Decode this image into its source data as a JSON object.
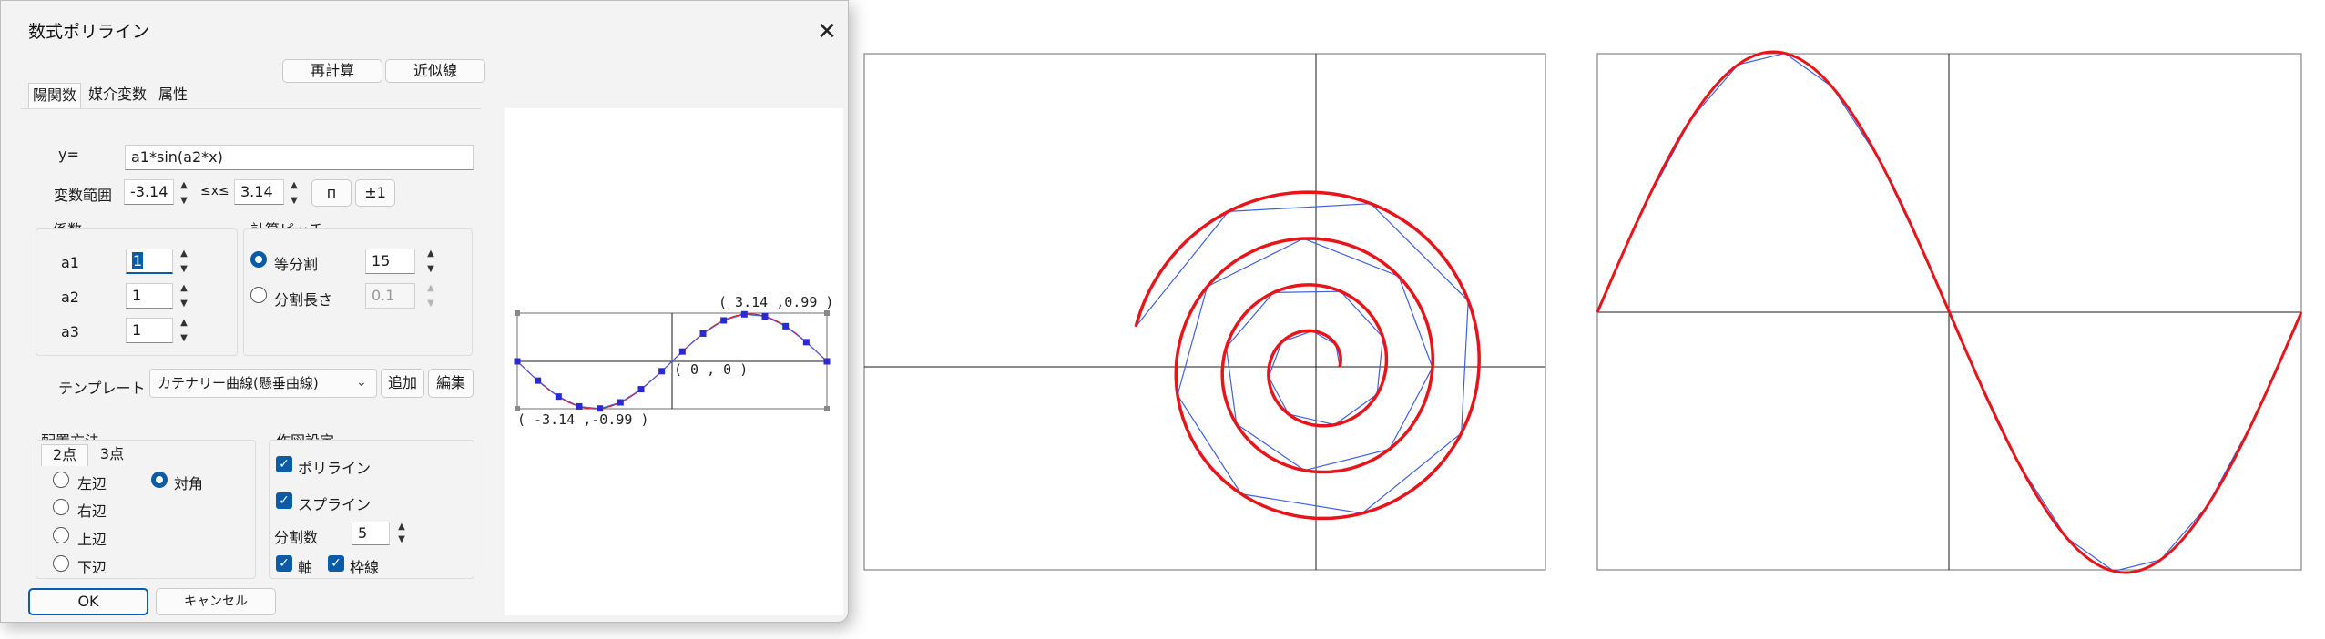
{
  "dialog": {
    "title": "数式ポリライン",
    "close_icon": "close-icon",
    "recalc_label": "再計算",
    "approx_label": "近似線",
    "tabs": [
      {
        "label": "陽関数",
        "active": true
      },
      {
        "label": "媒介変数",
        "active": false
      },
      {
        "label": "属性",
        "active": false
      }
    ],
    "formula": {
      "label": "y=",
      "value": "a1*sin(a2*x)"
    },
    "range": {
      "label": "変数範囲",
      "min": "-3.14",
      "mid_label": "≤x≤",
      "max": "3.14",
      "pi_button": "п",
      "pm1_button": "±1"
    },
    "coefficients": {
      "title": "係数",
      "items": [
        {
          "label": "a1",
          "value": "1"
        },
        {
          "label": "a2",
          "value": "1"
        },
        {
          "label": "a3",
          "value": "1"
        }
      ]
    },
    "pitch": {
      "title": "計算ピッチ",
      "equal_label": "等分割",
      "equal_value": "15",
      "length_label": "分割長さ",
      "length_value": "0.1",
      "selected": "等分割"
    },
    "template": {
      "label": "テンプレート",
      "selected": "カテナリー曲線(懸垂曲線)",
      "add_label": "追加",
      "edit_label": "編集"
    },
    "placement": {
      "title": "配置方法",
      "tabs": [
        "2点",
        "3点"
      ],
      "options": [
        {
          "label": "左辺",
          "checked": false
        },
        {
          "label": "右辺",
          "checked": false
        },
        {
          "label": "上辺",
          "checked": false
        },
        {
          "label": "下辺",
          "checked": false
        },
        {
          "label": "対角",
          "checked": true
        }
      ]
    },
    "drawing": {
      "title": "作図設定",
      "polyline_label": "ポリライン",
      "spline_label": "スプライン",
      "divisions_label": "分割数",
      "divisions_value": "5",
      "axis_label": "軸",
      "frame_label": "枠線",
      "polyline_checked": true,
      "spline_checked": true,
      "axis_checked": true,
      "frame_checked": true
    },
    "ok_label": "OK",
    "cancel_label": "キャンセル",
    "preview": {
      "max_label": "( 3.14 ,0.99 )",
      "origin_label": "( 0 , 0 )",
      "min_label": "( -3.14 ,-0.99 )"
    }
  },
  "colors": {
    "curve_red": "#e8141a",
    "polyline_blue": "#3f5fe0",
    "point_blue": "#2a2ad0",
    "accent": "#0a5ca8",
    "axis": "#1a1a1a",
    "frame": "#6e6e6e"
  }
}
